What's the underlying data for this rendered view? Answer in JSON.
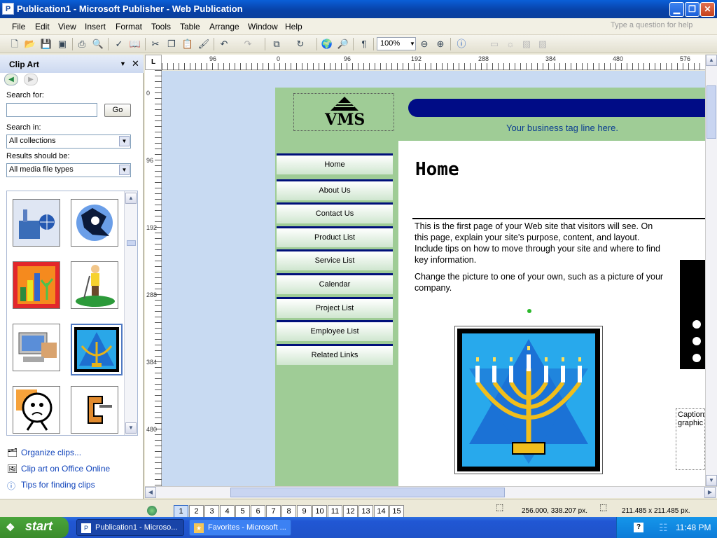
{
  "window": {
    "title": "Publication1 - Microsoft Publisher - Web Publication",
    "min_icon": "minimize-icon",
    "max_icon": "restore-icon",
    "close_icon": "close-icon"
  },
  "menubar": {
    "items": [
      "File",
      "Edit",
      "View",
      "Insert",
      "Format",
      "Tools",
      "Table",
      "Arrange",
      "Window",
      "Help"
    ],
    "ask_placeholder": "Type a question for help"
  },
  "toolbar": {
    "zoom": "100%"
  },
  "clipart": {
    "title": "Clip Art",
    "search_for_label": "Search for:",
    "search_value": "",
    "go_label": "Go",
    "search_in_label": "Search in:",
    "search_in_value": "All collections",
    "results_label": "Results should be:",
    "results_value": "All media file types",
    "links": [
      "Organize clips...",
      "Clip art on Office Online",
      "Tips for finding clips"
    ]
  },
  "rulers": {
    "horizontal": [
      "96",
      "0",
      "96",
      "192",
      "288",
      "384",
      "480",
      "576"
    ],
    "vertical": [
      "0",
      "96",
      "192",
      "288",
      "384",
      "480"
    ]
  },
  "page": {
    "logo": "VMS",
    "tagline": "Your business tag line here.",
    "nav": [
      "Home",
      "About Us",
      "Contact Us",
      "Product List",
      "Service List",
      "Calendar",
      "Project List",
      "Employee List",
      "Related Links"
    ],
    "heading": "Home",
    "para1": "This is the first page of your Web site that visitors will see. On this page, explain your site's purpose, content, and layout. Include tips on how to move through your site and where to find key information.",
    "para2": "Change the picture to one of your own, such as a picture of your company.",
    "caption": "Caption graphic"
  },
  "status": {
    "pages": [
      "1",
      "2",
      "3",
      "4",
      "5",
      "6",
      "7",
      "8",
      "9",
      "10",
      "11",
      "12",
      "13",
      "14",
      "15"
    ],
    "position": "256.000, 338.207 px.",
    "size": "211.485 x 211.485 px."
  },
  "taskbar": {
    "start": "start",
    "tasks": [
      "Publication1 - Microso...",
      "Favorites - Microsoft ..."
    ],
    "clock": "11:48 PM"
  }
}
